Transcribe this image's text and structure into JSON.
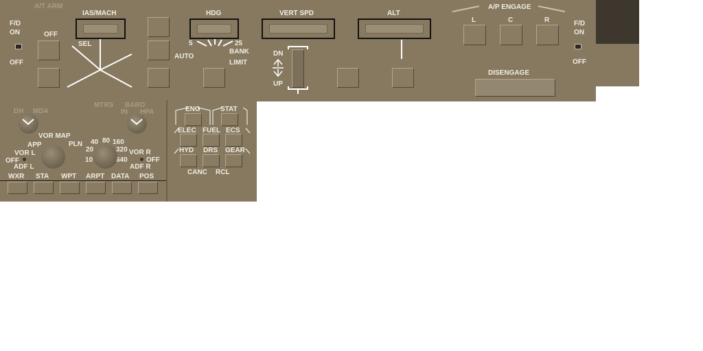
{
  "mcp": {
    "at_arm": "A/T ARM",
    "fd_left": {
      "title": "F/D",
      "on": "ON",
      "off": "OFF"
    },
    "at_off": "OFF",
    "ias_mach": "IAS/MACH",
    "sel": "SEL",
    "auto": "AUTO",
    "hdg": "HDG",
    "bank_5": "5",
    "bank_25": "25",
    "bank": "BANK",
    "limit": "LIMIT",
    "vert_spd": "VERT SPD",
    "dn": "DN",
    "up": "UP",
    "alt": "ALT",
    "ap_engage": "A/P ENGAGE",
    "ap_l": "L",
    "ap_c": "C",
    "ap_r": "R",
    "disengage": "DISENGAGE",
    "fd_right": {
      "title": "F/D",
      "on": "ON",
      "off": "OFF"
    }
  },
  "efis": {
    "dh": "DH",
    "mda": "MDA",
    "mtrs": "MTRS",
    "baro": "BARO",
    "in": "IN",
    "hpa": "HPA",
    "vor_map": "VOR MAP",
    "app": "APP",
    "pln": "PLN",
    "vor_l": "VOR L",
    "off_l": "OFF",
    "adf_l": "ADF L",
    "r40": "40",
    "r80": "80",
    "r160": "160",
    "r20": "20",
    "r320": "320",
    "r10": "10",
    "r640": "640",
    "vor_r": "VOR R",
    "off_r": "OFF",
    "adf_r": "ADF R",
    "buttons": [
      "WXR",
      "STA",
      "WPT",
      "ARPT",
      "DATA",
      "POS"
    ]
  },
  "eicas": {
    "eng": "ENG",
    "stat": "STAT",
    "elec": "ELEC",
    "fuel": "FUEL",
    "ecs": "ECS",
    "hyd": "HYD",
    "drs": "DRS",
    "gear": "GEAR",
    "canc": "CANC",
    "rcl": "RCL"
  },
  "colors": {
    "panel": "#867960",
    "text": "#f1ece2",
    "dark_block": "#3d372e"
  }
}
